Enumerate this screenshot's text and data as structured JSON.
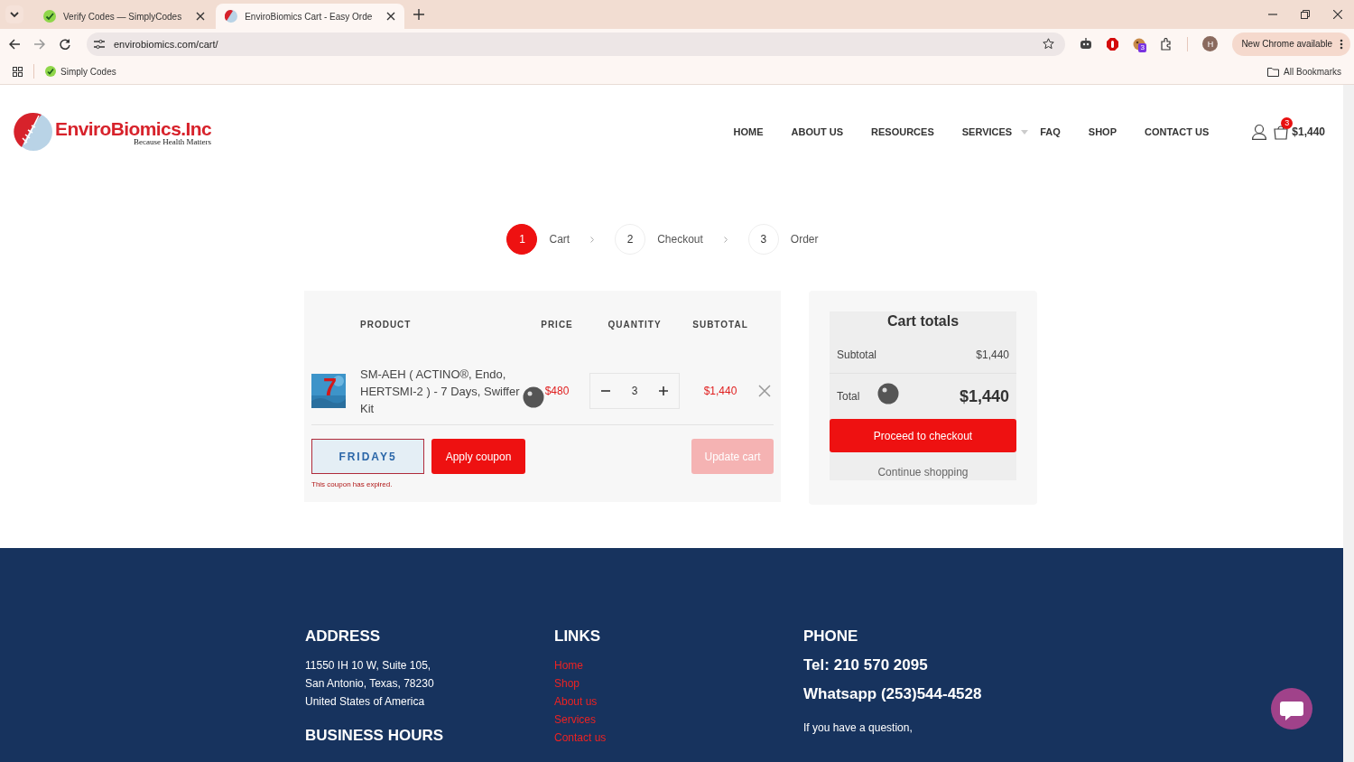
{
  "browser": {
    "tabs": [
      {
        "title": "Verify Codes — SimplyCodes",
        "selected": false,
        "kind": "check"
      },
      {
        "title": "EnviroBiomics Cart - Easy Orde",
        "selected": true,
        "kind": "logo"
      }
    ],
    "url": "envirobiomics.com/cart/",
    "extension_badge": "3",
    "profile": "H",
    "update_label": "New Chrome available",
    "bookmarks": [
      {
        "label": "Simply Codes"
      }
    ],
    "all_bookmarks": "All Bookmarks"
  },
  "header": {
    "logo": {
      "name": "EnviroBiomics.Inc",
      "tagline": "Because Health Matters"
    },
    "nav": [
      {
        "label": "HOME",
        "dropdown": false
      },
      {
        "label": "ABOUT US",
        "dropdown": false
      },
      {
        "label": "RESOURCES",
        "dropdown": false
      },
      {
        "label": "SERVICES",
        "dropdown": true
      },
      {
        "label": "FAQ",
        "dropdown": false
      },
      {
        "label": "SHOP",
        "dropdown": false
      },
      {
        "label": "CONTACT US",
        "dropdown": false
      }
    ],
    "cart_count": "3",
    "cart_total": "$1,440"
  },
  "steps": [
    {
      "number": "1",
      "label": "Cart",
      "selected": true
    },
    {
      "number": "2",
      "label": "Checkout",
      "selected": false
    },
    {
      "number": "3",
      "label": "Order",
      "selected": false
    }
  ],
  "cart": {
    "columns": [
      "PRODUCT",
      "PRICE",
      "QUANTITY",
      "SUBTOTAL"
    ],
    "rows": [
      {
        "thumbnail": "7",
        "product": "SM-AEH ( ACTINO®, Endo, HERTSMI-2 ) - 7 Days, Swiffer Kit",
        "price": "$480",
        "quantity": "3",
        "subtotal": "$1,440"
      }
    ],
    "coupon": {
      "value": "FRIDAY5",
      "error": "This coupon has expired."
    },
    "apply_label": "Apply coupon",
    "update": {
      "label": "Update cart",
      "disabled": true
    }
  },
  "totals": {
    "title": "Cart totals",
    "subtotal_label": "Subtotal",
    "subtotal": "$1,440",
    "total_label": "Total",
    "total": "$1,440",
    "checkout_label": "Proceed to checkout",
    "continue_label": "Continue shopping"
  },
  "footer": {
    "columns": [
      {
        "heading": "ADDRESS",
        "lines": [
          "11550 IH 10 W, Suite 105,",
          "San Antonio, Texas, 78230",
          "United States of America"
        ],
        "next_heading": "BUSINESS HOURS"
      },
      {
        "heading": "LINKS",
        "links": [
          "Home",
          "Shop",
          "About us",
          "Services",
          "Contact us"
        ]
      },
      {
        "heading": "PHONE",
        "phones": [
          "Tel: 210 570 2095",
          "Whatsapp (253)544-4528"
        ],
        "note": "If you have a question,"
      }
    ]
  }
}
